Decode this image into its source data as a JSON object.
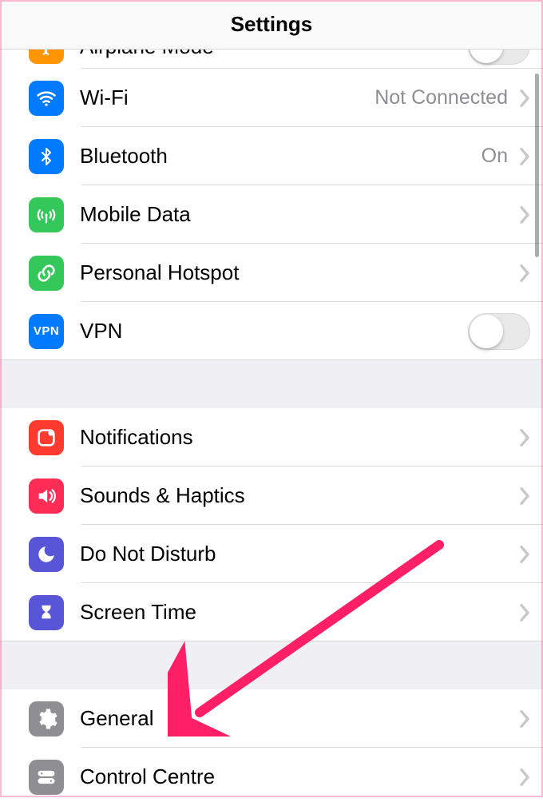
{
  "header": {
    "title": "Settings"
  },
  "groups": [
    {
      "rows": [
        {
          "id": "airplane",
          "icon": "airplane-icon",
          "color": "bg-orange",
          "label": "Airplane Mode",
          "control": "toggle",
          "toggle": false,
          "partial": true
        },
        {
          "id": "wifi",
          "icon": "wifi-icon",
          "color": "bg-blue",
          "label": "Wi-Fi",
          "value": "Not Connected",
          "control": "disclosure"
        },
        {
          "id": "bluetooth",
          "icon": "bluetooth-icon",
          "color": "bg-blue",
          "label": "Bluetooth",
          "value": "On",
          "control": "disclosure"
        },
        {
          "id": "mobiledata",
          "icon": "antenna-icon",
          "color": "bg-green",
          "label": "Mobile Data",
          "control": "disclosure"
        },
        {
          "id": "hotspot",
          "icon": "link-icon",
          "color": "bg-green",
          "label": "Personal Hotspot",
          "control": "disclosure"
        },
        {
          "id": "vpn",
          "icon": "vpn-icon",
          "color": "bg-bluev",
          "label": "VPN",
          "control": "toggle",
          "toggle": false
        }
      ]
    },
    {
      "rows": [
        {
          "id": "notifications",
          "icon": "notifications-icon",
          "color": "bg-red",
          "label": "Notifications",
          "control": "disclosure"
        },
        {
          "id": "sounds",
          "icon": "speaker-icon",
          "color": "bg-pinkred",
          "label": "Sounds & Haptics",
          "control": "disclosure"
        },
        {
          "id": "dnd",
          "icon": "moon-icon",
          "color": "bg-purple",
          "label": "Do Not Disturb",
          "control": "disclosure"
        },
        {
          "id": "screentime",
          "icon": "hourglass-icon",
          "color": "bg-purple",
          "label": "Screen Time",
          "control": "disclosure"
        }
      ]
    },
    {
      "rows": [
        {
          "id": "general",
          "icon": "gear-icon",
          "color": "bg-gray",
          "label": "General",
          "control": "disclosure"
        },
        {
          "id": "controlcentre",
          "icon": "switches-icon",
          "color": "bg-gray",
          "label": "Control Centre",
          "control": "disclosure"
        }
      ]
    }
  ],
  "annotation": {
    "target": "general",
    "color": "#ff1f66"
  }
}
